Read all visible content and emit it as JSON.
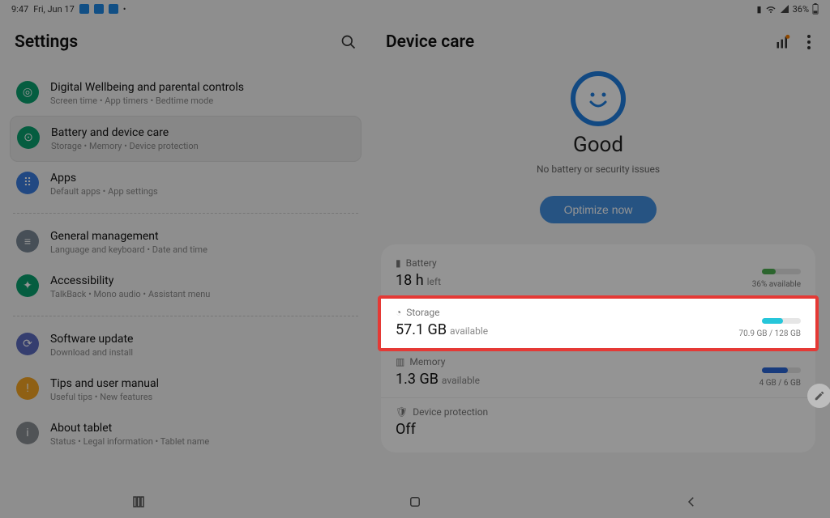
{
  "statusbar": {
    "time": "9:47",
    "date": "Fri, Jun 17",
    "battery_pct": "36%"
  },
  "left": {
    "title": "Settings",
    "items": [
      {
        "title": "Digital Wellbeing and parental controls",
        "sub": "Screen time  •  App timers  •  Bedtime mode"
      },
      {
        "title": "Battery and device care",
        "sub": "Storage  •  Memory  •  Device protection"
      },
      {
        "title": "Apps",
        "sub": "Default apps  •  App settings"
      },
      {
        "title": "General management",
        "sub": "Language and keyboard  •  Date and time"
      },
      {
        "title": "Accessibility",
        "sub": "TalkBack  •  Mono audio  •  Assistant menu"
      },
      {
        "title": "Software update",
        "sub": "Download and install"
      },
      {
        "title": "Tips and user manual",
        "sub": "Useful tips  •  New features"
      },
      {
        "title": "About tablet",
        "sub": "Status  •  Legal information  •  Tablet name"
      }
    ]
  },
  "right": {
    "title": "Device care",
    "status_word": "Good",
    "status_sub": "No battery or security issues",
    "optimize": "Optimize now",
    "battery": {
      "label": "Battery",
      "value": "18 h",
      "unit": "left",
      "right": "36% available"
    },
    "storage": {
      "label": "Storage",
      "value": "57.1 GB",
      "unit": "available",
      "right": "70.9 GB / 128 GB"
    },
    "memory": {
      "label": "Memory",
      "value": "1.3 GB",
      "unit": "available",
      "right": "4 GB / 6 GB"
    },
    "protection": {
      "label": "Device protection",
      "value": "Off"
    }
  }
}
